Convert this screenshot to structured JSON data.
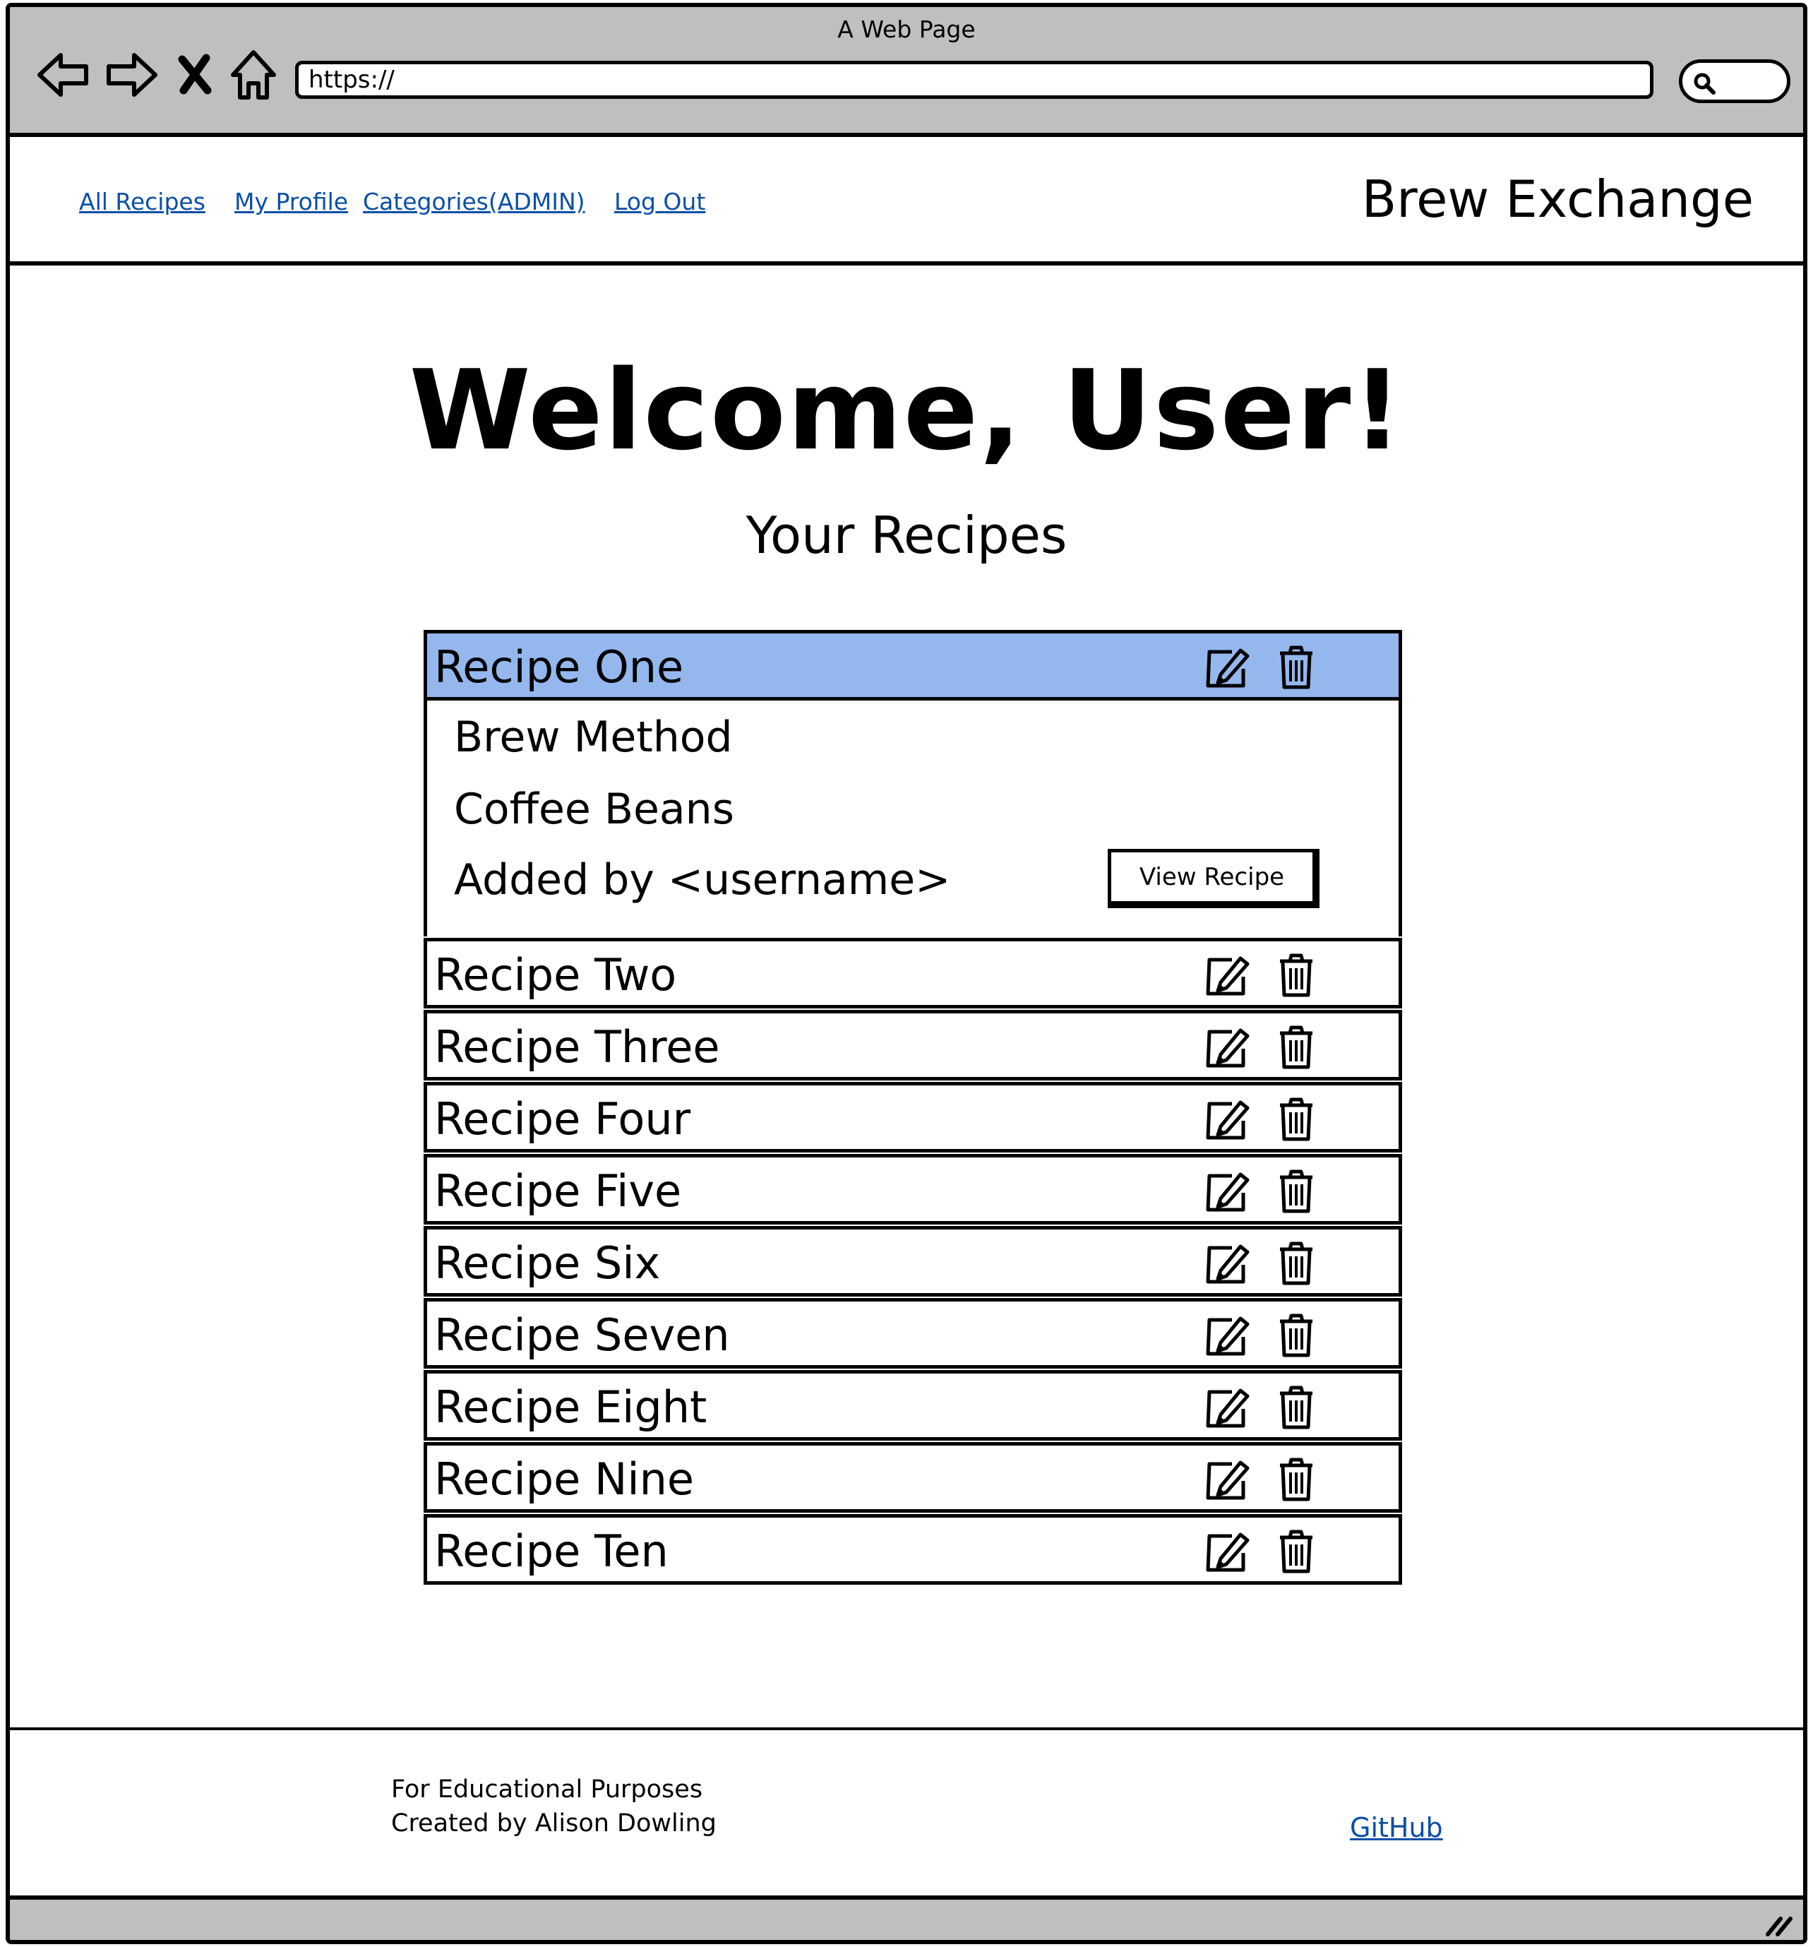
{
  "browser": {
    "title": "A Web Page",
    "url": "https://",
    "icons": [
      "back-arrow-icon",
      "forward-arrow-icon",
      "close-icon",
      "home-icon",
      "search-icon"
    ]
  },
  "header": {
    "links": [
      "All Recipes",
      "My Profile",
      "Categories(ADMIN)",
      "Log Out"
    ],
    "brand": "Brew Exchange"
  },
  "main": {
    "welcome": "Welcome, User!",
    "subtitle": "Your Recipes",
    "selected": {
      "title": "Recipe One",
      "brew_method": "Brew Method",
      "coffee_beans": "Coffee Beans",
      "added_by": "Added by <username>",
      "view_button": "View Recipe"
    },
    "recipes": [
      "Recipe Two",
      "Recipe Three",
      "Recipe Four",
      "Recipe Five",
      "Recipe Six",
      "Recipe Seven",
      "Recipe Eight",
      "Recipe Nine",
      "Recipe Ten"
    ],
    "selected_color": "#94b8ee"
  },
  "footer": {
    "line1": "For Educational Purposes",
    "line2": "Created by Alison Dowling",
    "github": "GitHub",
    "link_color": "#0a4fa8"
  }
}
